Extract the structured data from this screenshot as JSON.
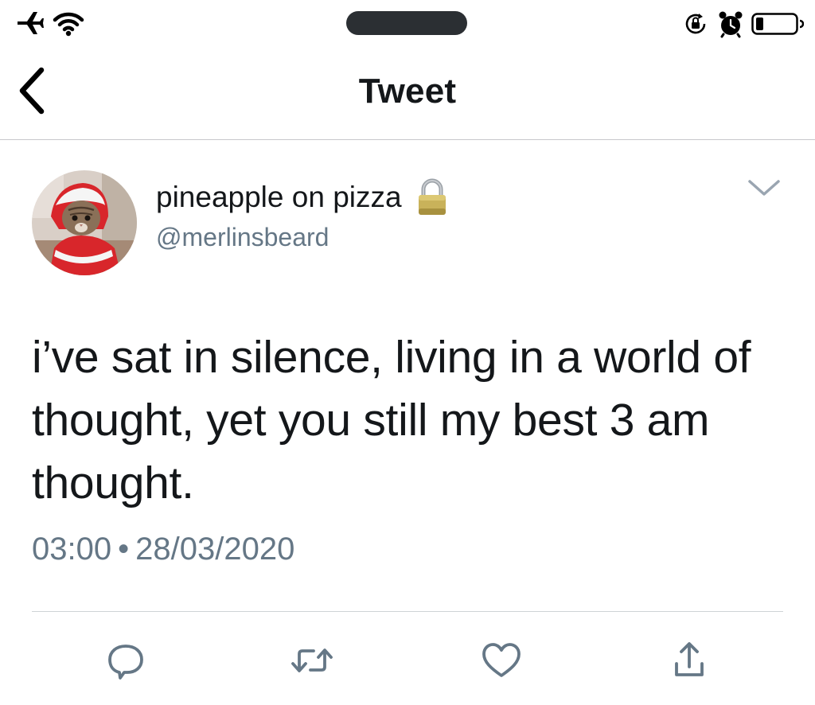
{
  "nav": {
    "title": "Tweet"
  },
  "tweet": {
    "display_name": "pineapple on pizza",
    "handle": "@merlinsbeard",
    "text": "i’ve sat in silence, living in a world of thought, yet you still my best 3 am thought.",
    "time": "03:00",
    "separator": "•",
    "date": "28/03/2020"
  },
  "icons": {
    "status_bar": [
      "airplane-icon",
      "wifi-icon",
      "rotation-lock-icon",
      "alarm-icon",
      "battery-icon"
    ],
    "nav": [
      "back-chevron-icon"
    ],
    "tweet_header": [
      "lock-icon",
      "chevron-down-icon"
    ],
    "actions": [
      "reply-icon",
      "retweet-icon",
      "like-icon",
      "share-icon"
    ]
  },
  "colors": {
    "text_primary": "#14171a",
    "text_secondary": "#657786",
    "action_icon": "#657786",
    "divider": "#cfd3d6",
    "avatar_hood_red": "#d8262b"
  }
}
